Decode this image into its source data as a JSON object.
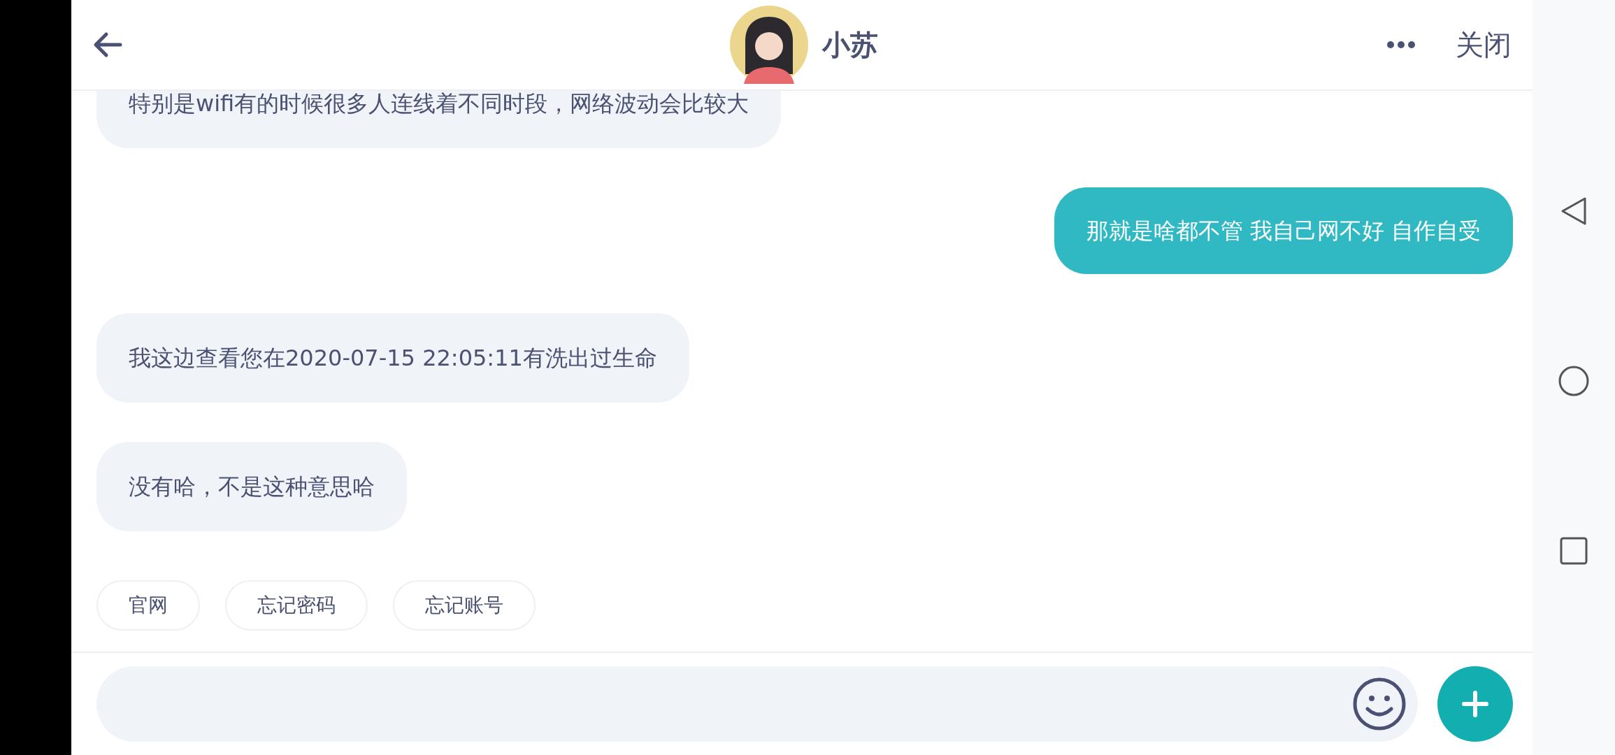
{
  "header": {
    "name": "小苏",
    "close": "关闭"
  },
  "messages": [
    {
      "kind": "received",
      "text": "特别是wifi有的时候很多人连线着不同时段，网络波动会比较大"
    },
    {
      "kind": "sent",
      "text": "那就是啥都不管 我自己网不好 自作自受"
    },
    {
      "kind": "received",
      "text": "我这边查看您在2020-07-15 22:05:11有洗出过生命"
    },
    {
      "kind": "received",
      "text": "没有哈，不是这种意思哈"
    }
  ],
  "quick_replies": [
    "官网",
    "忘记密码",
    "忘记账号"
  ]
}
